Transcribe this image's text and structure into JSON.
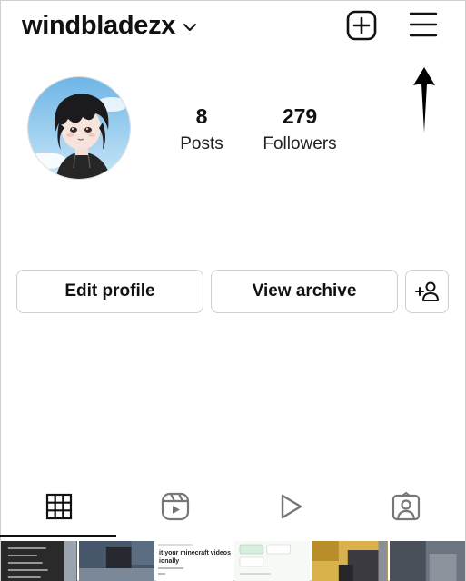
{
  "header": {
    "username": "windbladezx"
  },
  "icons": {
    "dropdown": "chevron-down-icon",
    "new_post": "plus-square-icon",
    "menu": "hamburger-menu-icon",
    "annotation": "arrow-up-icon"
  },
  "profile": {
    "stats": {
      "posts_count": "8",
      "posts_label": "Posts",
      "followers_count": "279",
      "followers_label": "Followers"
    }
  },
  "actions": {
    "edit_profile": "Edit profile",
    "view_archive": "View archive"
  },
  "tabs": [
    {
      "name": "grid",
      "icon": "grid-icon",
      "active": true
    },
    {
      "name": "reels",
      "icon": "reels-icon",
      "active": false
    },
    {
      "name": "videos",
      "icon": "play-icon",
      "active": false
    },
    {
      "name": "tagged",
      "icon": "tagged-person-icon",
      "active": false
    }
  ],
  "thumbnails": {
    "post3_caption": "it your minecraft videos ionally"
  },
  "colors": {
    "text": "#111111",
    "border": "#cfcfcf",
    "background": "#ffffff"
  }
}
